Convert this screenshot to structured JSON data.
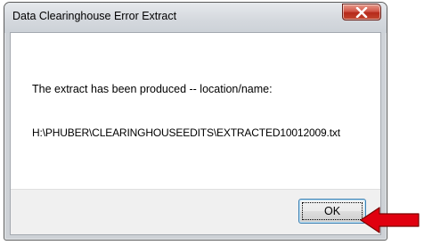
{
  "window": {
    "title": "Data Clearinghouse Error Extract"
  },
  "message": {
    "line1": "The extract has been produced -- location/name:",
    "line2": "H:\\PHUBER\\CLEARINGHOUSEEDITS\\EXTRACTED10012009.txt"
  },
  "buttons": {
    "ok_label": "OK"
  },
  "icons": {
    "close": "close-icon",
    "arrow": "red-arrow-left-icon"
  },
  "colors": {
    "close_button": "#c2402c",
    "arrow": "#e0000f",
    "ok_border": "#3c7fb1"
  }
}
